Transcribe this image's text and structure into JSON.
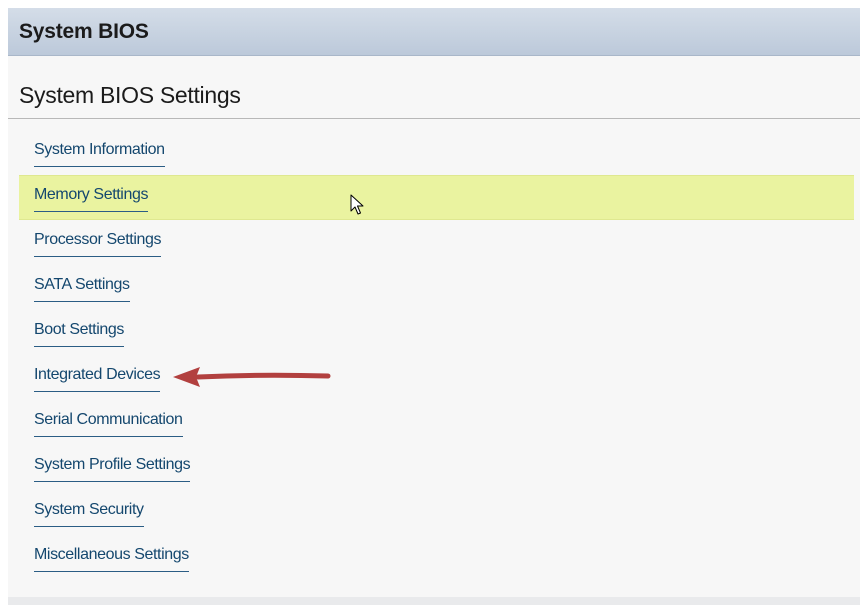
{
  "header": {
    "title": "System BIOS"
  },
  "section": {
    "title": "System BIOS Settings"
  },
  "menu": {
    "items": [
      {
        "label": "System Information"
      },
      {
        "label": "Memory Settings"
      },
      {
        "label": "Processor Settings"
      },
      {
        "label": "SATA Settings"
      },
      {
        "label": "Boot Settings"
      },
      {
        "label": "Integrated Devices"
      },
      {
        "label": "Serial Communication"
      },
      {
        "label": "System Profile Settings"
      },
      {
        "label": "System Security"
      },
      {
        "label": "Miscellaneous Settings"
      }
    ],
    "highlighted_item": "Memory Settings",
    "annotated_item": "Integrated Devices"
  },
  "colors": {
    "title_bar": "#c7d3e2",
    "highlight": "#eaf3a0",
    "link": "#14476e",
    "annotation_arrow": "#b2403f"
  },
  "icons": {
    "pointer": "mouse-pointer-icon",
    "annotation": "red-arrow-annotation"
  }
}
